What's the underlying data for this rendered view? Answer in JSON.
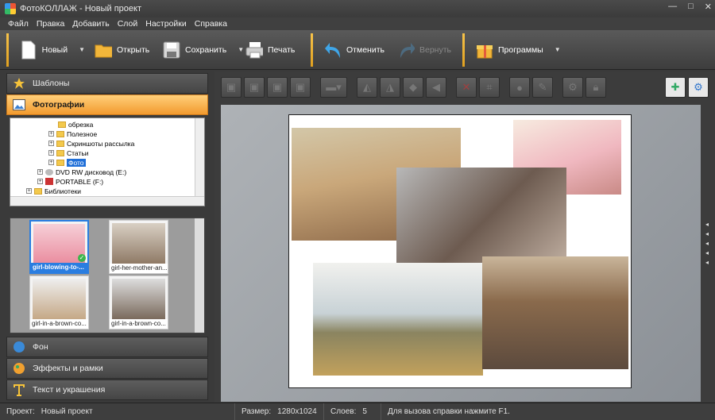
{
  "window": {
    "title": "ФотоКОЛЛАЖ - Новый проект"
  },
  "menu": [
    "Файл",
    "Правка",
    "Добавить",
    "Слой",
    "Настройки",
    "Справка"
  ],
  "toolbar": {
    "new": "Новый",
    "open": "Открыть",
    "save": "Сохранить",
    "print": "Печать",
    "undo": "Отменить",
    "redo": "Вернуть",
    "programs": "Программы"
  },
  "left_panel": {
    "templates": "Шаблоны",
    "photos": "Фотографии",
    "background": "Фон",
    "effects": "Эффекты и рамки",
    "text": "Текст и украшения"
  },
  "tree": [
    {
      "label": "обрезка"
    },
    {
      "label": "Полезное"
    },
    {
      "label": "Скриншоты рассылка"
    },
    {
      "label": "Статьи"
    },
    {
      "label": "Фото"
    },
    {
      "label": "DVD RW дисковод (E:)"
    },
    {
      "label": "PORTABLE (F:)"
    },
    {
      "label": "Библиотеки"
    }
  ],
  "thumbnails": [
    {
      "caption": "girl-blowing-to-..."
    },
    {
      "caption": "girl-her-mother-an..."
    },
    {
      "caption": "girl-in-a-brown-co..."
    },
    {
      "caption": "girl-in-a-brown-co..."
    }
  ],
  "status": {
    "project_label": "Проект:",
    "project_value": "Новый проект",
    "size_label": "Размер:",
    "size_value": "1280x1024",
    "layers_label": "Слоев:",
    "layers_value": "5",
    "hint": "Для вызова справки нажмите F1."
  }
}
